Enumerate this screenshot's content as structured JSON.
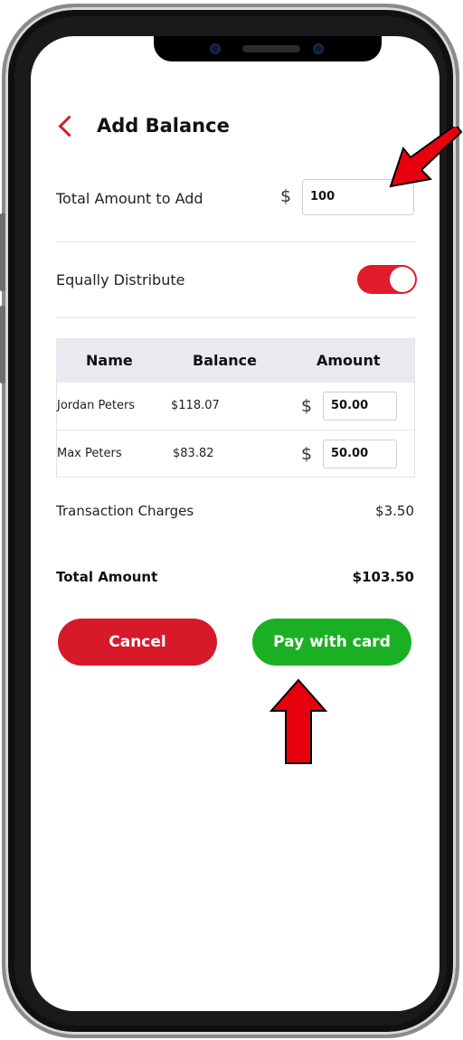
{
  "header": {
    "title": "Add Balance",
    "back_icon": "chevron-left-icon"
  },
  "total_amount": {
    "label": "Total Amount to Add",
    "currency": "$",
    "value": "100"
  },
  "distribute": {
    "label": "Equally Distribute",
    "enabled": true
  },
  "table": {
    "columns": [
      "Name",
      "Balance",
      "Amount"
    ],
    "rows": [
      {
        "name": "Jordan Peters",
        "balance": "$118.07",
        "currency": "$",
        "amount": "50.00"
      },
      {
        "name": "Max Peters",
        "balance": "$83.82",
        "currency": "$",
        "amount": "50.00"
      }
    ]
  },
  "summary": {
    "charges_label": "Transaction Charges",
    "charges_value": "$3.50",
    "total_label": "Total Amount",
    "total_value": "$103.50"
  },
  "actions": {
    "cancel_label": "Cancel",
    "pay_label": "Pay with card"
  },
  "colors": {
    "accent_red": "#d61a2a",
    "pay_green": "#1bb024",
    "toggle_red": "#e01c2c",
    "annotation_arrow": "#e8000d"
  }
}
